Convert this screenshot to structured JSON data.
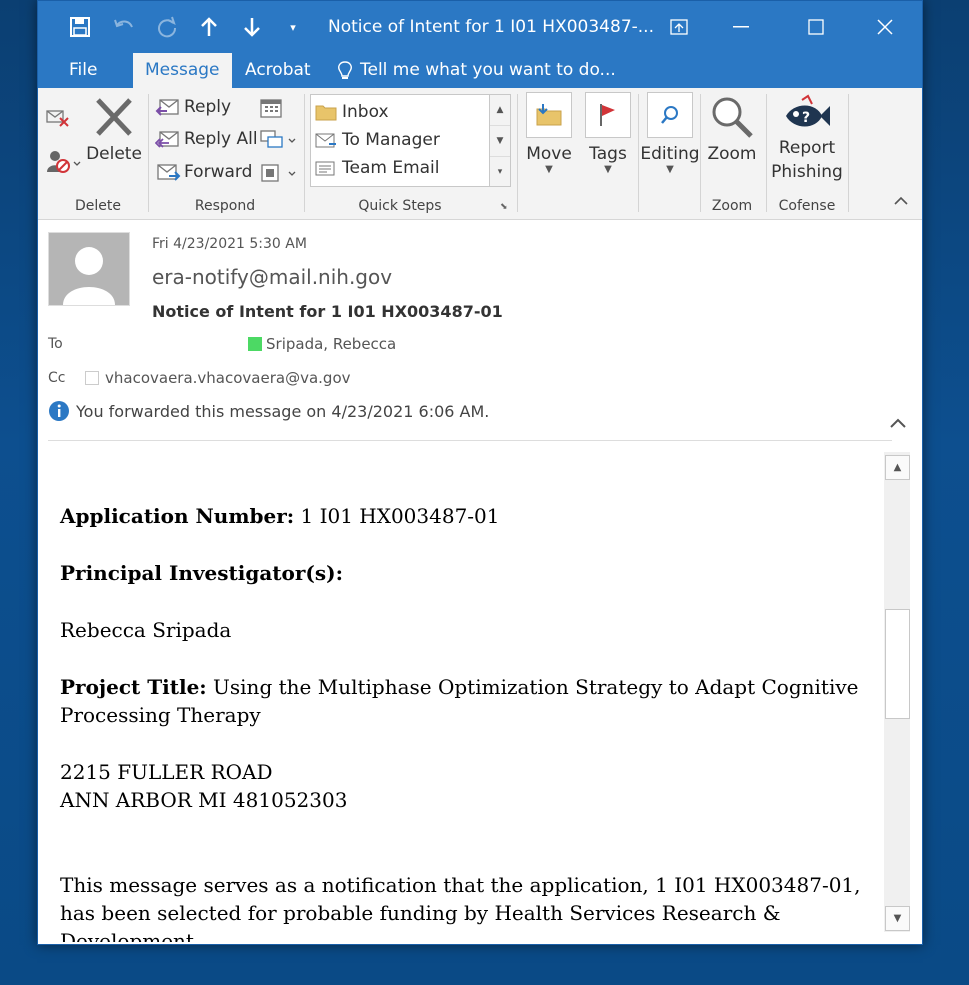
{
  "window": {
    "title": "Notice of Intent for 1 I01 HX003487-...",
    "tabs": [
      "File",
      "Message",
      "Acrobat"
    ],
    "tell_me": "Tell me what you want to do..."
  },
  "ribbon": {
    "delete_group": {
      "delete_label": "Delete",
      "group_label": "Delete"
    },
    "respond_group": {
      "reply": "Reply",
      "reply_all": "Reply All",
      "forward": "Forward",
      "group_label": "Respond"
    },
    "quick_steps": {
      "items": [
        "Inbox",
        "To Manager",
        "Team Email"
      ],
      "group_label": "Quick Steps"
    },
    "move": "Move",
    "tags": "Tags",
    "editing": "Editing",
    "zoom": {
      "label": "Zoom",
      "group_label": "Zoom"
    },
    "report": {
      "line1": "Report",
      "line2": "Phishing",
      "group_label": "Cofense"
    }
  },
  "header": {
    "date": "Fri 4/23/2021 5:30 AM",
    "from": "era-notify@mail.nih.gov",
    "subject": "Notice of Intent for 1 I01 HX003487-01",
    "to_label": "To",
    "to_value": "Sripada, Rebecca",
    "cc_label": "Cc",
    "cc_value": "vhacovaera.vhacovaera@va.gov",
    "info": "You forwarded this message on 4/23/2021 6:06 AM."
  },
  "message": {
    "app_num_label": "Application Number:",
    "app_num_value": " 1 I01 HX003487-01",
    "pi_label": "Principal Investigator(s):",
    "pi_value": "Rebecca Sripada",
    "title_label": "Project Title:",
    "title_value": " Using the Multiphase Optimization Strategy to Adapt Cognitive Processing Therapy",
    "address_line1": "2215 FULLER ROAD",
    "address_line2": "ANN ARBOR MI 481052303",
    "notice": "This message serves as a notification that the application, 1 I01 HX003487-01, has been selected for probable funding by Health Services Research & Development."
  },
  "colors": {
    "brand": "#2b78c4",
    "ribbon_bg": "#f3f3f3"
  }
}
